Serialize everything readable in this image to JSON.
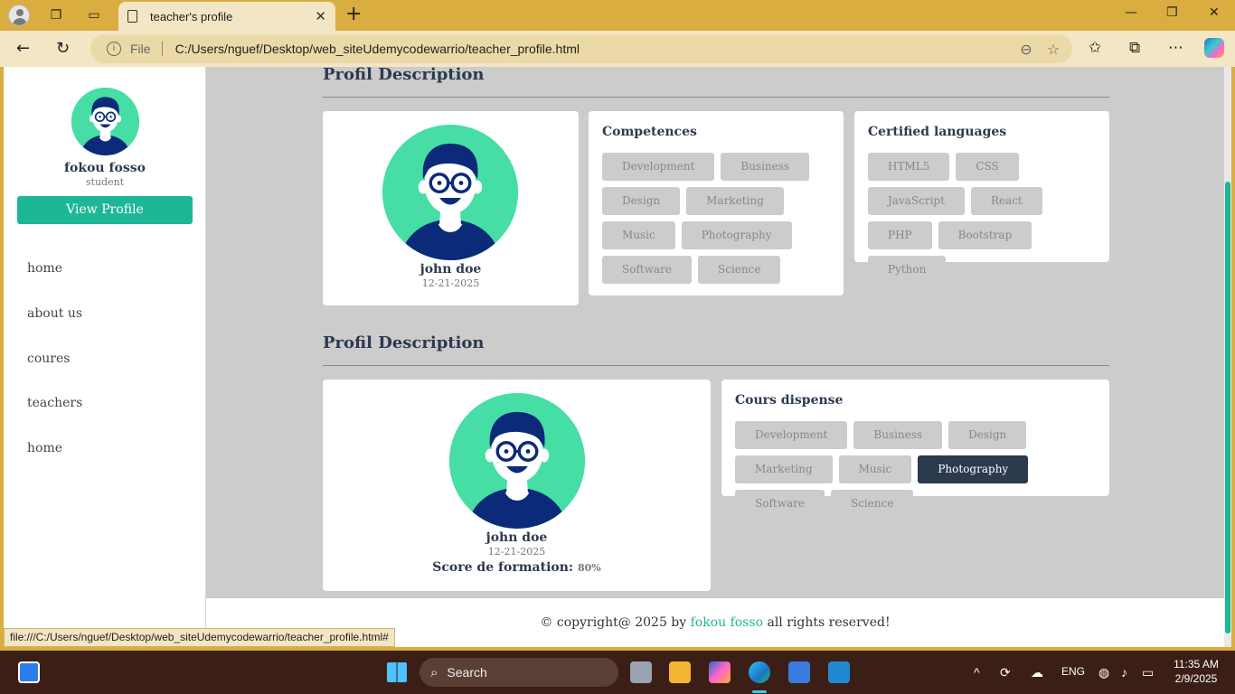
{
  "browser": {
    "tab_title": "teacher's profile",
    "file_label": "File",
    "url": "C:/Users/nguef/Desktop/web_siteUdemycodewarrio/teacher_profile.html",
    "status_url": "file:///C:/Users/nguef/Desktop/web_siteUdemycodewarrio/teacher_profile.html#"
  },
  "sidebar": {
    "user_name": "fokou fosso",
    "user_role": "student",
    "view_profile_label": "View Profile",
    "links": [
      "home",
      "about us",
      "coures",
      "teachers",
      "home"
    ]
  },
  "section1": {
    "title": "Profil Description",
    "profile": {
      "name": "john doe",
      "date": "12-21-2025"
    },
    "competences": {
      "title": "Competences",
      "tags": [
        "Development",
        "Business",
        "Design",
        "Marketing",
        "Music",
        "Photography",
        "Software",
        "Science"
      ]
    },
    "languages": {
      "title": "Certified languages",
      "tags": [
        "HTML5",
        "CSS",
        "JavaScript",
        "React",
        "PHP",
        "Bootstrap",
        "Python"
      ]
    }
  },
  "section2": {
    "title": "Profil Description",
    "profile": {
      "name": "john doe",
      "date": "12-21-2025",
      "score_label": "Score de formation:",
      "score_value": "80%"
    },
    "courses": {
      "title": "Cours dispense",
      "tags": [
        "Development",
        "Business",
        "Design",
        "Marketing",
        "Music",
        "Photography",
        "Software",
        "Science"
      ],
      "active": "Photography"
    }
  },
  "footer": {
    "prefix": "© copyright@ 2025 by",
    "name": "fokou fosso",
    "suffix": "all rights reserved!"
  },
  "taskbar": {
    "search_placeholder": "Search",
    "language": "ENG",
    "time": "11:35 AM",
    "date": "2/9/2025"
  },
  "colors": {
    "accent": "#1eb795",
    "avatar_bg": "#46dea4",
    "heading": "#2c3a4e",
    "tag_bg": "#cccccc",
    "page_bg": "#cccccc",
    "browser_frame": "#d9ad3f"
  }
}
